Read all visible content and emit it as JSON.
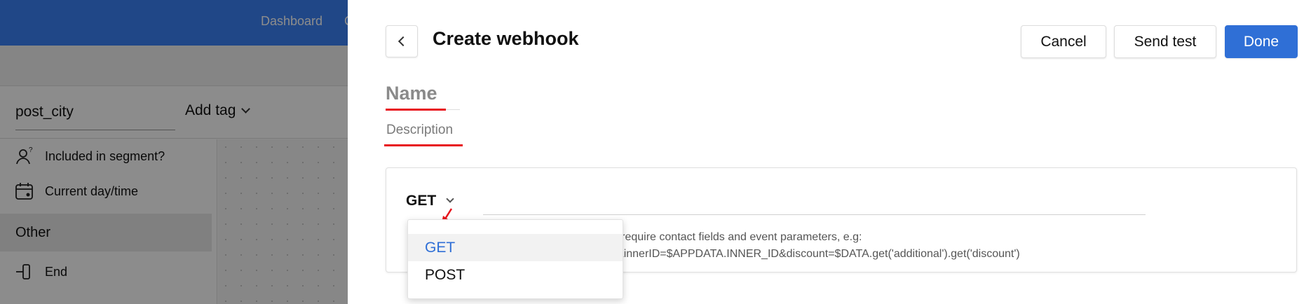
{
  "background": {
    "nav": [
      "Dashboard",
      "C"
    ],
    "filter": {
      "tag_value": "post_city",
      "add_tag_label": "Add tag"
    },
    "sidebar": [
      {
        "label": "Included in segment?",
        "icon": "segment-users-icon"
      },
      {
        "label": "Current day/time",
        "icon": "calendar-clock-icon"
      },
      {
        "label": "Other",
        "section": true
      },
      {
        "label": "End",
        "icon": "end-flow-icon"
      }
    ]
  },
  "panel": {
    "title": "Create webhook",
    "buttons": {
      "cancel": "Cancel",
      "send_test": "Send test",
      "done": "Done"
    },
    "name_placeholder": "Name",
    "description_placeholder": "Description",
    "request": {
      "method": "GET",
      "hint_line1": "sible to require contact fields and event parameters, e.g:",
      "hint_line2": "EMAIL&innerID=$APPDATA.INNER_ID&discount=$DATA.get('additional').get('discount')"
    },
    "method_options": [
      "GET",
      "POST"
    ],
    "selected_method": "GET"
  },
  "colors": {
    "primary": "#2f6fd6",
    "annotation_red": "#e8141c",
    "topbar": "#3b82f6"
  }
}
